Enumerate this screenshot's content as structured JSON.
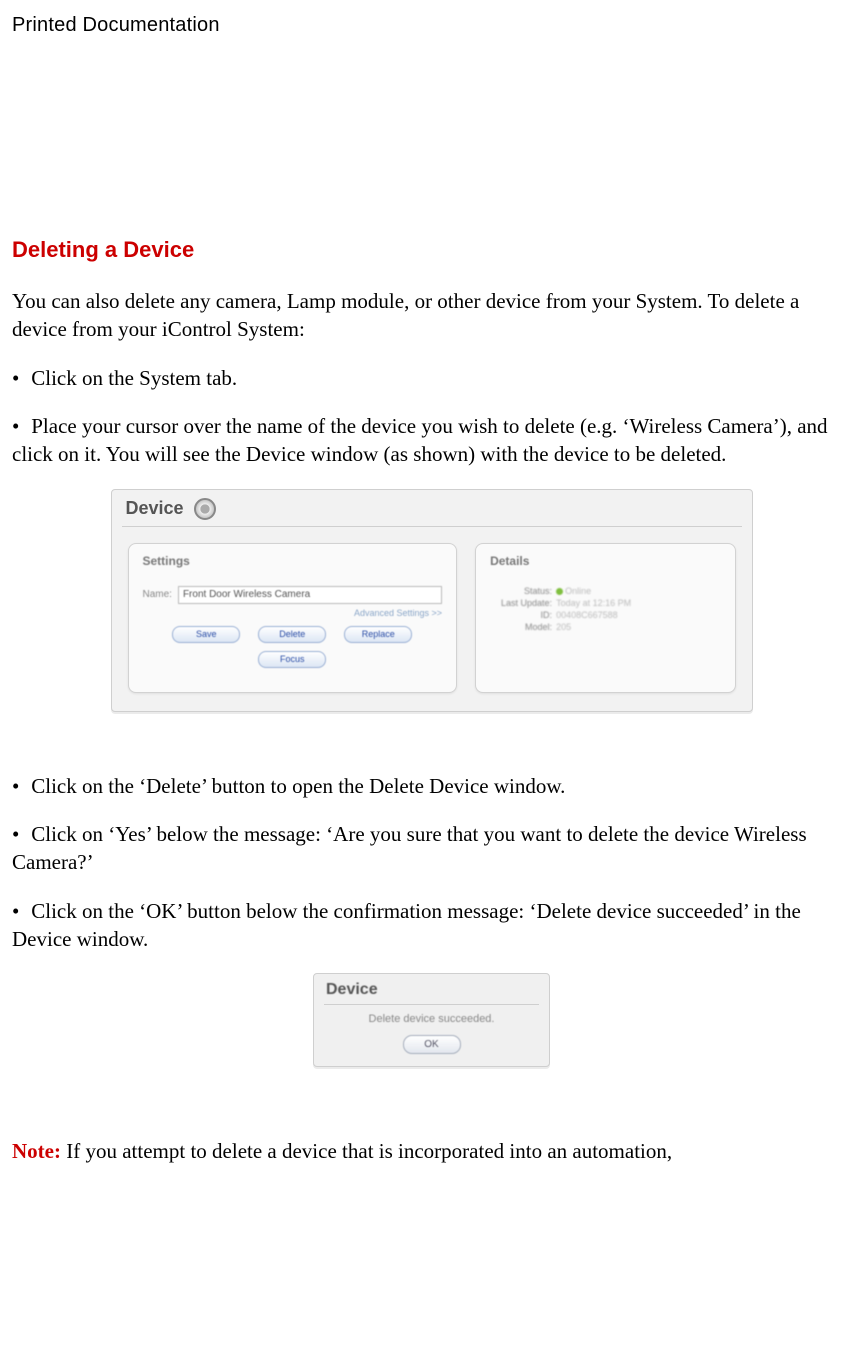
{
  "header": "Printed Documentation",
  "section_title": "Deleting a Device",
  "intro": "You can also delete any camera, Lamp module, or other device from your System. To delete a device from your iControl System:",
  "bullets": {
    "b1": "Click on the System tab.",
    "b2": "Place your cursor over the name of the device you wish to delete (e.g. ‘Wireless Camera’), and click on it. You will see the Device window (as shown) with the device to be deleted.",
    "b3": "Click on the ‘Delete’ button to open the Delete Device window.",
    "b4": "Click on ‘Yes’ below the message: ‘Are you sure that you want to delete the device Wireless Camera?’",
    "b5": "Click on the ‘OK’ button below the confirmation message: ‘Delete device succeeded’ in the Device window."
  },
  "note": {
    "label": "Note:",
    "text": " If you attempt to delete a device that is incorporated into an automation,"
  },
  "fig1": {
    "title": "Device",
    "settings": {
      "title": "Settings",
      "name_label": "Name:",
      "name_value": "Front Door Wireless Camera",
      "advanced": "Advanced Settings >>",
      "buttons": {
        "save": "Save",
        "delete": "Delete",
        "replace": "Replace",
        "focus": "Focus"
      }
    },
    "details": {
      "title": "Details",
      "rows": {
        "status_label": "Status:",
        "status_value": "Online",
        "last_update_label": "Last Update:",
        "last_update_value": "Today at 12:16 PM",
        "id_label": "ID:",
        "id_value": "00408C667588",
        "model_label": "Model:",
        "model_value": "205"
      }
    }
  },
  "fig2": {
    "title": "Device",
    "message": "Delete device succeeded.",
    "ok": "OK"
  }
}
